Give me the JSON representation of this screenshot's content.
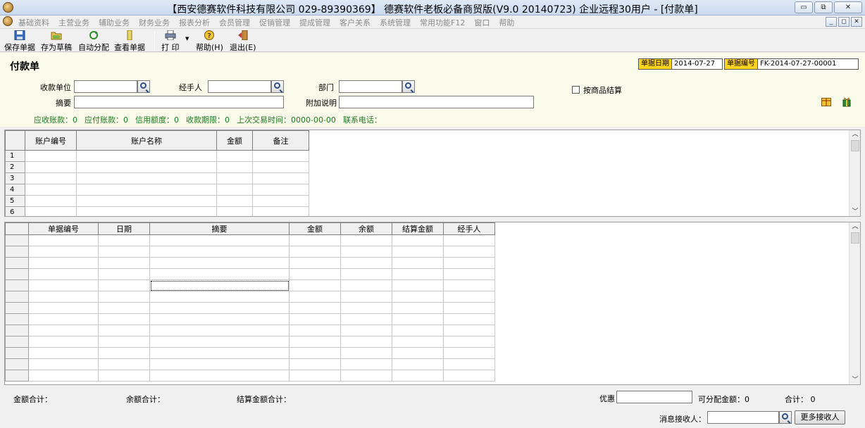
{
  "window": {
    "title": "【西安德赛软件科技有限公司 029-89390369】 德赛软件老板必备商贸版(V9.0 20140723) 企业远程30用户 - [付款单]",
    "btn_min": "▭",
    "btn_max": "⧉",
    "btn_close": "✕"
  },
  "menu": {
    "items": [
      "基础资料",
      "主营业务",
      "辅助业务",
      "财务业务",
      "报表分析",
      "会员管理",
      "促销管理",
      "提成管理",
      "客户关系",
      "系统管理",
      "常用功能F12",
      "窗口",
      "帮助"
    ],
    "mdi_min": "_",
    "mdi_restore": "◻",
    "mdi_close": "✕"
  },
  "toolbar": {
    "save": "保存单据",
    "draft": "存为草稿",
    "auto": "自动分配",
    "view": "查看单据",
    "print": "打 印",
    "print_arrow": "▼",
    "help": "帮助(H)",
    "exit": "退出(E)"
  },
  "form": {
    "title": "付款单",
    "date_label": "单据日期",
    "date_value": "2014-07-27",
    "no_label": "单据编号",
    "no_value": "FK-2014-07-27-00001",
    "payee_label": "收款单位",
    "payee_value": "",
    "handler_label": "经手人",
    "handler_value": "",
    "dept_label": "部门",
    "dept_value": "",
    "summary_label": "摘要",
    "summary_value": "",
    "note_label": "附加说明",
    "note_value": "",
    "by_goods_label": "按商品结算",
    "info": [
      "应收账款：0",
      "应付账款：0",
      "信用额度：0",
      "收款期限：0",
      "上次交易时间：0000-00-00",
      "联系电话："
    ]
  },
  "grid1": {
    "headers": [
      "账户编号",
      "账户名称",
      "金额",
      "备注"
    ],
    "rows": [
      "1",
      "2",
      "3",
      "4",
      "5",
      "6"
    ]
  },
  "grid2": {
    "headers": [
      "单据编号",
      "日期",
      "摘要",
      "金额",
      "余额",
      "结算金额",
      "经手人"
    ]
  },
  "footer": {
    "amount_total": "金额合计：",
    "balance_total": "余额合计：",
    "settle_total": "结算金额合计：",
    "discount_label": "优惠",
    "discount_value": "",
    "allocatable": "可分配金额：0",
    "total": "合计： 0",
    "recipient_label": "消息接收人：",
    "recipient_value": "",
    "more_recipients": "更多接收人"
  },
  "colors": {
    "header_bg": "#fbfbeb",
    "label_yellow": "#ffd21e",
    "info_green": "#1f7a1f"
  }
}
